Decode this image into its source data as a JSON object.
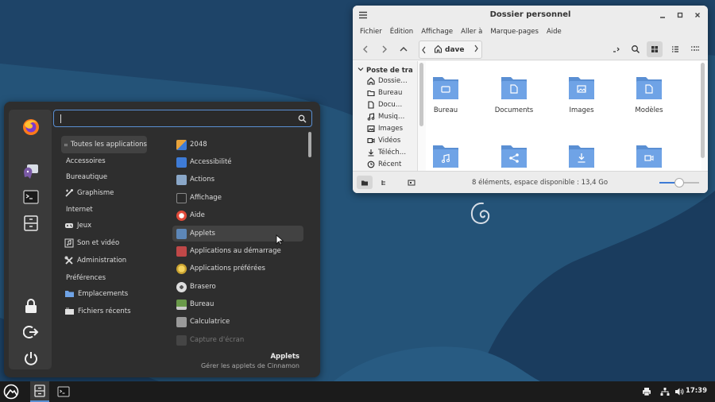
{
  "file_manager": {
    "title": "Dossier personnel",
    "menu": [
      "Fichier",
      "Édition",
      "Affichage",
      "Aller à",
      "Marque-pages",
      "Aide"
    ],
    "path_crumb": "dave",
    "sidebar_header": "Poste de travail",
    "sidebar_items": [
      "Dossie…",
      "Bureau",
      "Docu…",
      "Musiq…",
      "Images",
      "Vidéos",
      "Téléch…",
      "Récent"
    ],
    "folders": [
      {
        "label": "Bureau",
        "icon": "desktop"
      },
      {
        "label": "Documents",
        "icon": "document"
      },
      {
        "label": "Images",
        "icon": "image"
      },
      {
        "label": "Modèles",
        "icon": "template"
      },
      {
        "label": "",
        "icon": "music"
      },
      {
        "label": "",
        "icon": "share"
      },
      {
        "label": "",
        "icon": "download"
      },
      {
        "label": "",
        "icon": "video"
      }
    ],
    "status": "8 éléments, espace disponible : 13,4 Go",
    "zoom_level": 0.5
  },
  "menu": {
    "search_placeholder": "",
    "categories": [
      {
        "label": "Toutes les applications",
        "icon": "grid-icon",
        "selected": true
      },
      {
        "label": "Accessoires",
        "icon": ""
      },
      {
        "label": "Bureautique",
        "icon": ""
      },
      {
        "label": "Graphisme",
        "icon": "graphics-icon"
      },
      {
        "label": "Internet",
        "icon": ""
      },
      {
        "label": "Jeux",
        "icon": "gamepad-icon"
      },
      {
        "label": "Son et vidéo",
        "icon": "media-icon"
      },
      {
        "label": "Administration",
        "icon": "tools-icon"
      },
      {
        "label": "Préférences",
        "icon": ""
      },
      {
        "label": "Emplacements",
        "icon": "folder-icon"
      },
      {
        "label": "Fichiers récents",
        "icon": "recent-icon"
      }
    ],
    "apps": [
      {
        "label": "2048",
        "color": "#e8a33b"
      },
      {
        "label": "Accessibilité",
        "color": "#3e7bd6"
      },
      {
        "label": "Actions",
        "color": "#8aa7c8"
      },
      {
        "label": "Affichage",
        "color": "#2a2a2a"
      },
      {
        "label": "Aide",
        "color": "#e04a3a"
      },
      {
        "label": "Applets",
        "color": "#5d87b8"
      },
      {
        "label": "Applications au démarrage",
        "color": "#c04848"
      },
      {
        "label": "Applications préférées",
        "color": "#e8c04a"
      },
      {
        "label": "Brasero",
        "color": "#dddddd"
      },
      {
        "label": "Bureau",
        "color": "#6a9a4a"
      },
      {
        "label": "Calculatrice",
        "color": "#9a9a9a"
      },
      {
        "label": "Capture d'écran",
        "color": "#555555"
      }
    ],
    "hovered_app": "Applets",
    "description": {
      "name": "Applets",
      "text": "Gérer les applets de Cinnamon"
    }
  },
  "panel": {
    "clock": "17:39"
  },
  "colors": {
    "accent": "#5a8fd3",
    "folder": "#6fa3e6",
    "folder_dark": "#5a8fd3"
  }
}
